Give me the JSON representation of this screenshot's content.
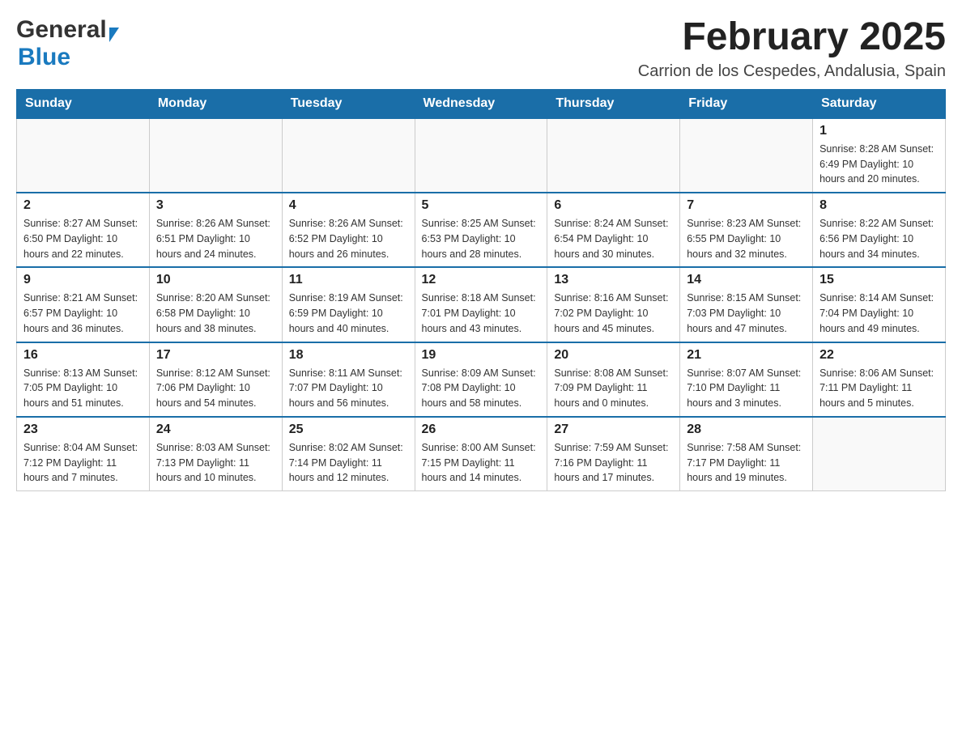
{
  "header": {
    "logo_general": "General",
    "logo_blue": "Blue",
    "month_title": "February 2025",
    "location": "Carrion de los Cespedes, Andalusia, Spain"
  },
  "weekdays": [
    "Sunday",
    "Monday",
    "Tuesday",
    "Wednesday",
    "Thursday",
    "Friday",
    "Saturday"
  ],
  "weeks": [
    [
      {
        "day": "",
        "info": ""
      },
      {
        "day": "",
        "info": ""
      },
      {
        "day": "",
        "info": ""
      },
      {
        "day": "",
        "info": ""
      },
      {
        "day": "",
        "info": ""
      },
      {
        "day": "",
        "info": ""
      },
      {
        "day": "1",
        "info": "Sunrise: 8:28 AM\nSunset: 6:49 PM\nDaylight: 10 hours and 20 minutes."
      }
    ],
    [
      {
        "day": "2",
        "info": "Sunrise: 8:27 AM\nSunset: 6:50 PM\nDaylight: 10 hours and 22 minutes."
      },
      {
        "day": "3",
        "info": "Sunrise: 8:26 AM\nSunset: 6:51 PM\nDaylight: 10 hours and 24 minutes."
      },
      {
        "day": "4",
        "info": "Sunrise: 8:26 AM\nSunset: 6:52 PM\nDaylight: 10 hours and 26 minutes."
      },
      {
        "day": "5",
        "info": "Sunrise: 8:25 AM\nSunset: 6:53 PM\nDaylight: 10 hours and 28 minutes."
      },
      {
        "day": "6",
        "info": "Sunrise: 8:24 AM\nSunset: 6:54 PM\nDaylight: 10 hours and 30 minutes."
      },
      {
        "day": "7",
        "info": "Sunrise: 8:23 AM\nSunset: 6:55 PM\nDaylight: 10 hours and 32 minutes."
      },
      {
        "day": "8",
        "info": "Sunrise: 8:22 AM\nSunset: 6:56 PM\nDaylight: 10 hours and 34 minutes."
      }
    ],
    [
      {
        "day": "9",
        "info": "Sunrise: 8:21 AM\nSunset: 6:57 PM\nDaylight: 10 hours and 36 minutes."
      },
      {
        "day": "10",
        "info": "Sunrise: 8:20 AM\nSunset: 6:58 PM\nDaylight: 10 hours and 38 minutes."
      },
      {
        "day": "11",
        "info": "Sunrise: 8:19 AM\nSunset: 6:59 PM\nDaylight: 10 hours and 40 minutes."
      },
      {
        "day": "12",
        "info": "Sunrise: 8:18 AM\nSunset: 7:01 PM\nDaylight: 10 hours and 43 minutes."
      },
      {
        "day": "13",
        "info": "Sunrise: 8:16 AM\nSunset: 7:02 PM\nDaylight: 10 hours and 45 minutes."
      },
      {
        "day": "14",
        "info": "Sunrise: 8:15 AM\nSunset: 7:03 PM\nDaylight: 10 hours and 47 minutes."
      },
      {
        "day": "15",
        "info": "Sunrise: 8:14 AM\nSunset: 7:04 PM\nDaylight: 10 hours and 49 minutes."
      }
    ],
    [
      {
        "day": "16",
        "info": "Sunrise: 8:13 AM\nSunset: 7:05 PM\nDaylight: 10 hours and 51 minutes."
      },
      {
        "day": "17",
        "info": "Sunrise: 8:12 AM\nSunset: 7:06 PM\nDaylight: 10 hours and 54 minutes."
      },
      {
        "day": "18",
        "info": "Sunrise: 8:11 AM\nSunset: 7:07 PM\nDaylight: 10 hours and 56 minutes."
      },
      {
        "day": "19",
        "info": "Sunrise: 8:09 AM\nSunset: 7:08 PM\nDaylight: 10 hours and 58 minutes."
      },
      {
        "day": "20",
        "info": "Sunrise: 8:08 AM\nSunset: 7:09 PM\nDaylight: 11 hours and 0 minutes."
      },
      {
        "day": "21",
        "info": "Sunrise: 8:07 AM\nSunset: 7:10 PM\nDaylight: 11 hours and 3 minutes."
      },
      {
        "day": "22",
        "info": "Sunrise: 8:06 AM\nSunset: 7:11 PM\nDaylight: 11 hours and 5 minutes."
      }
    ],
    [
      {
        "day": "23",
        "info": "Sunrise: 8:04 AM\nSunset: 7:12 PM\nDaylight: 11 hours and 7 minutes."
      },
      {
        "day": "24",
        "info": "Sunrise: 8:03 AM\nSunset: 7:13 PM\nDaylight: 11 hours and 10 minutes."
      },
      {
        "day": "25",
        "info": "Sunrise: 8:02 AM\nSunset: 7:14 PM\nDaylight: 11 hours and 12 minutes."
      },
      {
        "day": "26",
        "info": "Sunrise: 8:00 AM\nSunset: 7:15 PM\nDaylight: 11 hours and 14 minutes."
      },
      {
        "day": "27",
        "info": "Sunrise: 7:59 AM\nSunset: 7:16 PM\nDaylight: 11 hours and 17 minutes."
      },
      {
        "day": "28",
        "info": "Sunrise: 7:58 AM\nSunset: 7:17 PM\nDaylight: 11 hours and 19 minutes."
      },
      {
        "day": "",
        "info": ""
      }
    ]
  ]
}
